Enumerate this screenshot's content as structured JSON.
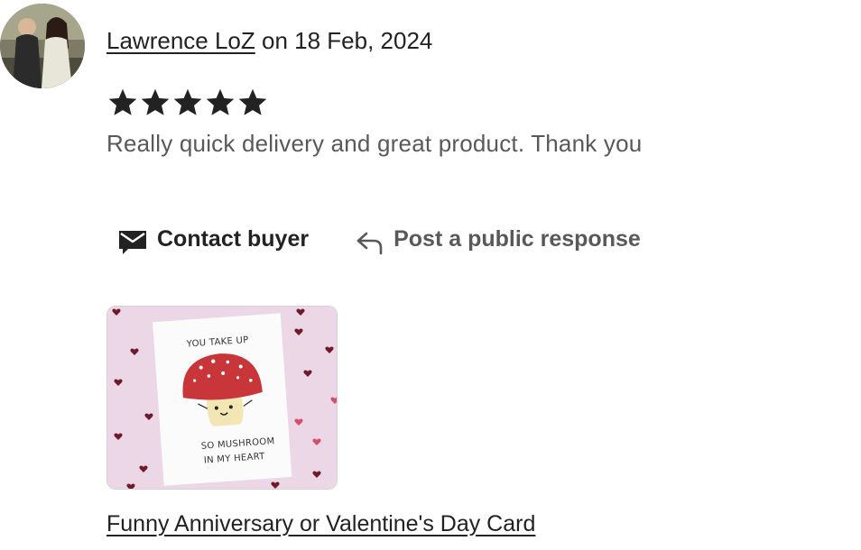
{
  "review": {
    "reviewer_name": "Lawrence LoZ",
    "date_text": "on 18 Feb, 2024",
    "rating": 5,
    "rating_max": 5,
    "text": "Really quick delivery and great product. Thank you"
  },
  "actions": {
    "contact_label": "Contact buyer",
    "contact_icon": "envelope-icon",
    "respond_label": "Post a public response",
    "respond_icon": "reply-arrow-icon"
  },
  "product": {
    "title": "Funny Anniversary or Valentine's Day Card",
    "card_text": {
      "line1": "YOU TAKE UP",
      "line2": "SO MUSHROOM",
      "line3": "IN MY HEART"
    }
  },
  "colors": {
    "text_primary": "#222222",
    "text_secondary": "#595959",
    "card_background": "#ecd7e6",
    "mushroom_cap": "#c8363a"
  }
}
